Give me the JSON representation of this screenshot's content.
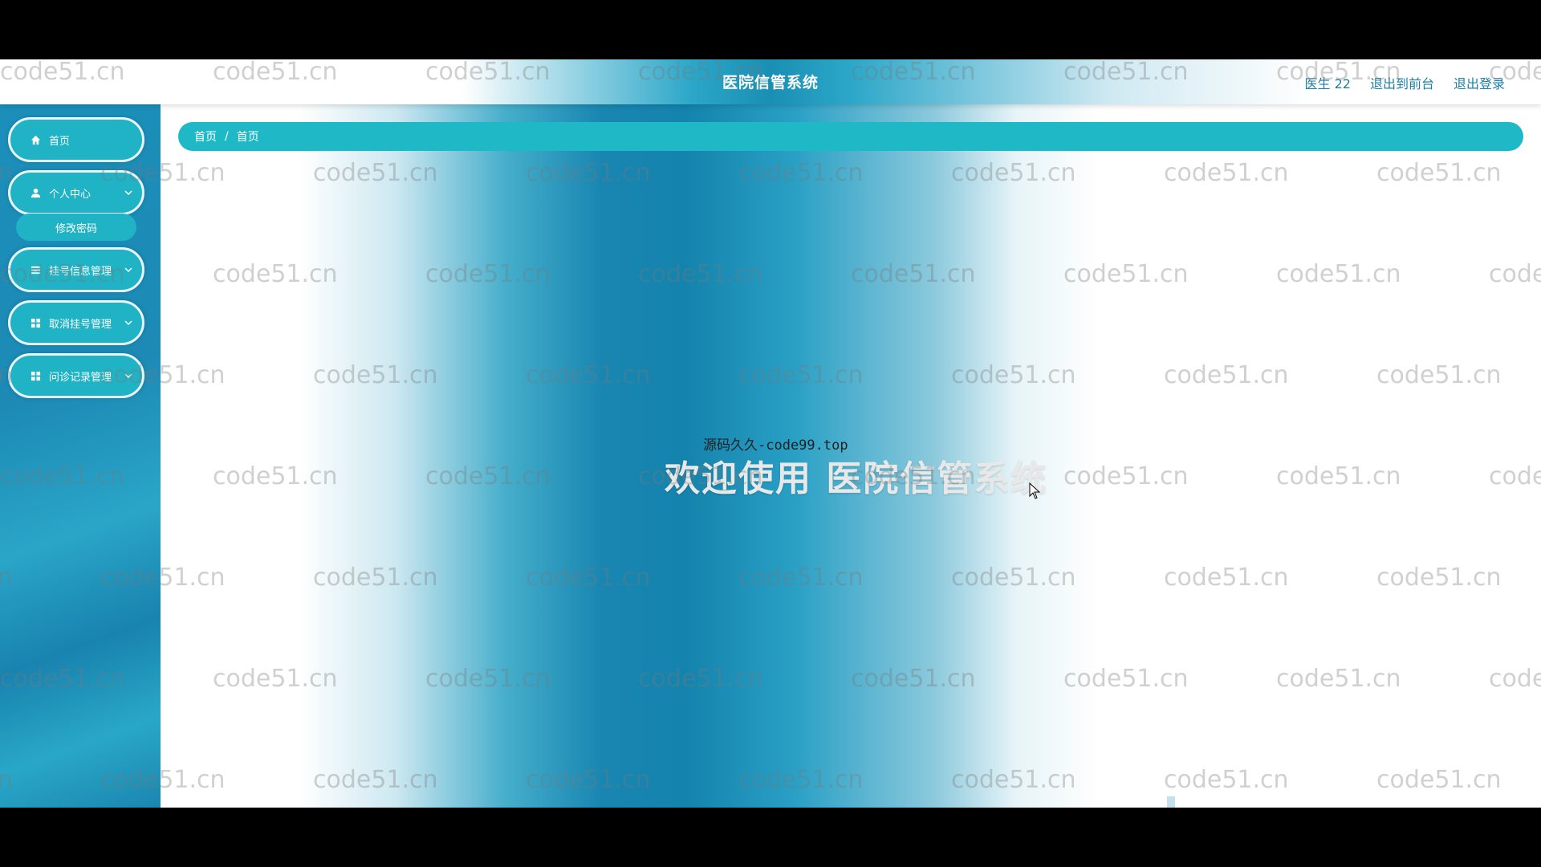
{
  "header": {
    "title": "医院信管系统",
    "user_label": "医生 22",
    "back_to_front": "退出到前台",
    "logout": "退出登录"
  },
  "sidebar": {
    "items": [
      {
        "label": "首页",
        "icon": "home-icon"
      },
      {
        "label": "个人中心",
        "icon": "user-icon",
        "expanded": true,
        "children": [
          {
            "label": "修改密码"
          }
        ]
      },
      {
        "label": "挂号信息管理",
        "icon": "list-icon"
      },
      {
        "label": "取消挂号管理",
        "icon": "grid-icon"
      },
      {
        "label": "问诊记录管理",
        "icon": "grid-icon"
      }
    ]
  },
  "breadcrumb": [
    "首页",
    "首页"
  ],
  "breadcrumb_separator": "/",
  "main": {
    "source_note": "源码久久-code99.top",
    "welcome": "欢迎使用 医院信管系统"
  },
  "watermark": "code51.cn",
  "colors": {
    "accent": "#1fb8c6",
    "sidebar_bg": "#1b8fba",
    "header_link": "#1d7fa7"
  }
}
